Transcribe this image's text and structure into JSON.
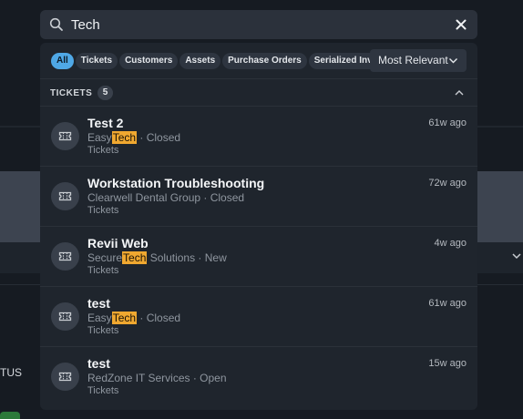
{
  "background": {
    "status_fragment": "TUS"
  },
  "search": {
    "query": "Tech",
    "icon": "search-icon",
    "clear_icon": "close-icon"
  },
  "filters": {
    "chips": [
      {
        "label": "All",
        "active": true
      },
      {
        "label": "Tickets",
        "active": false
      },
      {
        "label": "Customers",
        "active": false
      },
      {
        "label": "Assets",
        "active": false
      },
      {
        "label": "Purchase Orders",
        "active": false
      },
      {
        "label": "Serialized Inventory",
        "active": false
      }
    ],
    "sort": {
      "label": "Most Relevant",
      "icon": "chevron-down-icon"
    }
  },
  "section": {
    "label": "TICKETS",
    "count": "5",
    "collapse_icon": "chevron-up-icon"
  },
  "results": [
    {
      "title": "Test 2",
      "sub_before": "Easy",
      "sub_match": "Tech",
      "sub_after": " · Closed",
      "category": "Tickets",
      "time": "61w ago",
      "icon": "ticket-icon"
    },
    {
      "title": "Workstation Troubleshooting",
      "sub_before": "Clearwell Dental Group · Closed",
      "sub_match": "",
      "sub_after": "",
      "category": "Tickets",
      "time": "72w ago",
      "icon": "ticket-icon"
    },
    {
      "title": "Revii Web",
      "sub_before": "Secure",
      "sub_match": "Tech",
      "sub_after": " Solutions · New",
      "category": "Tickets",
      "time": "4w ago",
      "icon": "ticket-icon"
    },
    {
      "title": "test",
      "sub_before": "Easy",
      "sub_match": "Tech",
      "sub_after": " · Closed",
      "category": "Tickets",
      "time": "61w ago",
      "icon": "ticket-icon"
    },
    {
      "title": "test",
      "sub_before": "RedZone IT Services · Open",
      "sub_match": "",
      "sub_after": "",
      "category": "Tickets",
      "time": "15w ago",
      "icon": "ticket-icon"
    }
  ],
  "colors": {
    "accent": "#4fa8e6",
    "highlight": "#f0a830",
    "panel": "#1f252d"
  }
}
